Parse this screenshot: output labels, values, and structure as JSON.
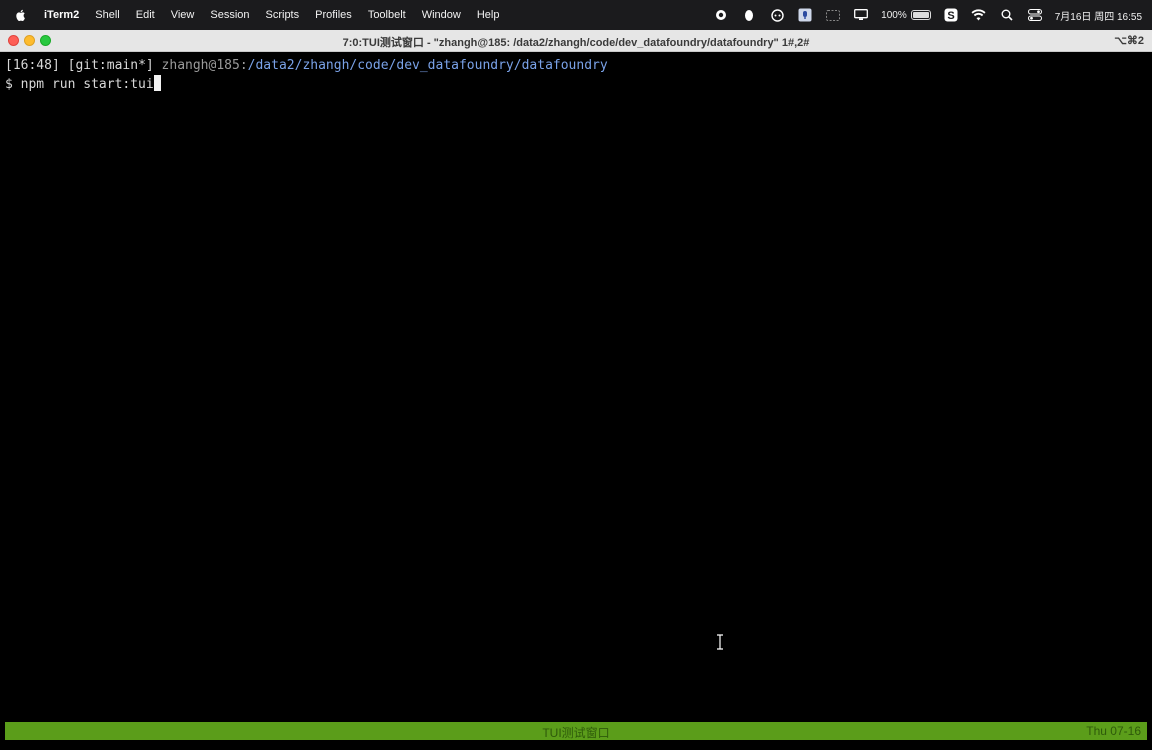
{
  "menubar": {
    "app_name": "iTerm2",
    "menus": [
      "Shell",
      "Edit",
      "View",
      "Session",
      "Scripts",
      "Profiles",
      "Toolbelt",
      "Window",
      "Help"
    ],
    "battery_percent": "100%",
    "clock": "7月16日 周四  16:55"
  },
  "window": {
    "title": "7:0:TUI测试窗口 - \"zhangh@185: /data2/zhangh/code/dev_datafoundry/datafoundry\" 1#,2#",
    "shortcut": "⌥⌘2"
  },
  "terminal": {
    "prompt_time": "[16:48]",
    "prompt_git": "[git:main*]",
    "prompt_user": "zhangh@185",
    "prompt_sep": ":",
    "prompt_path": "/data2/zhangh/code/dev_datafoundry/datafoundry",
    "prompt_symbol": "$",
    "command": "npm run start:tui"
  },
  "statusbar": {
    "center": "TUI测试窗口",
    "right": "Thu 07-16"
  }
}
